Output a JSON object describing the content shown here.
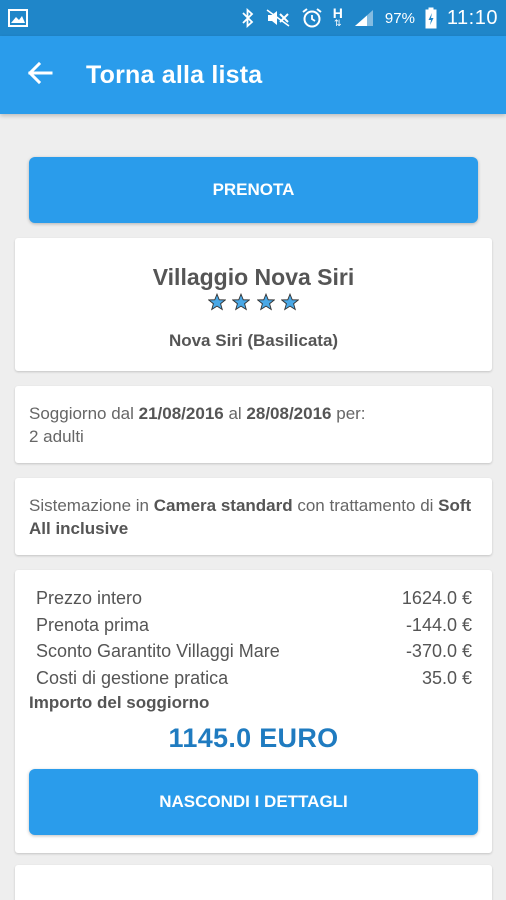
{
  "status_bar": {
    "battery_percent": "97%",
    "time": "11:10",
    "network_label": "H",
    "icons": [
      "image-icon",
      "bluetooth-icon",
      "mute-icon",
      "alarm-icon",
      "network-h-icon",
      "signal-icon",
      "battery-icon"
    ]
  },
  "app_bar": {
    "back_icon": "arrow-back-icon",
    "title": "Torna alla lista"
  },
  "book_button": {
    "label": "PRENOTA"
  },
  "hotel": {
    "name": "Villaggio Nova Siri",
    "rating_stars": 4,
    "location": "Nova Siri (Basilicata)"
  },
  "stay": {
    "prefix": "Soggiorno dal ",
    "date_from": "21/08/2016",
    "middle": " al ",
    "date_to": "28/08/2016",
    "suffix": " per:",
    "guests": "2 adulti"
  },
  "accommodation": {
    "prefix": "Sistemazione in ",
    "room": "Camera standard",
    "middle": " con trattamento di ",
    "board": "Soft All inclusive"
  },
  "pricing": {
    "rows": [
      {
        "label": "Prezzo intero",
        "value": "1624.0 €"
      },
      {
        "label": "Prenota prima",
        "value": "-144.0 €"
      },
      {
        "label": "Sconto Garantito Villaggi Mare",
        "value": "-370.0 €"
      },
      {
        "label": "Costi di gestione pratica",
        "value": "35.0 €"
      }
    ],
    "total_label": "Importo del soggiorno",
    "total_value": "1145.0 EURO",
    "toggle_button_label": "NASCONDI I DETTAGLI"
  },
  "colors": {
    "status_bar": "#1f86c9",
    "app_bar": "#2a9ceb",
    "button": "#2a9ceb",
    "total_text": "#1f7bc0",
    "star": "#4aa8e6",
    "background": "#eeeeee"
  }
}
